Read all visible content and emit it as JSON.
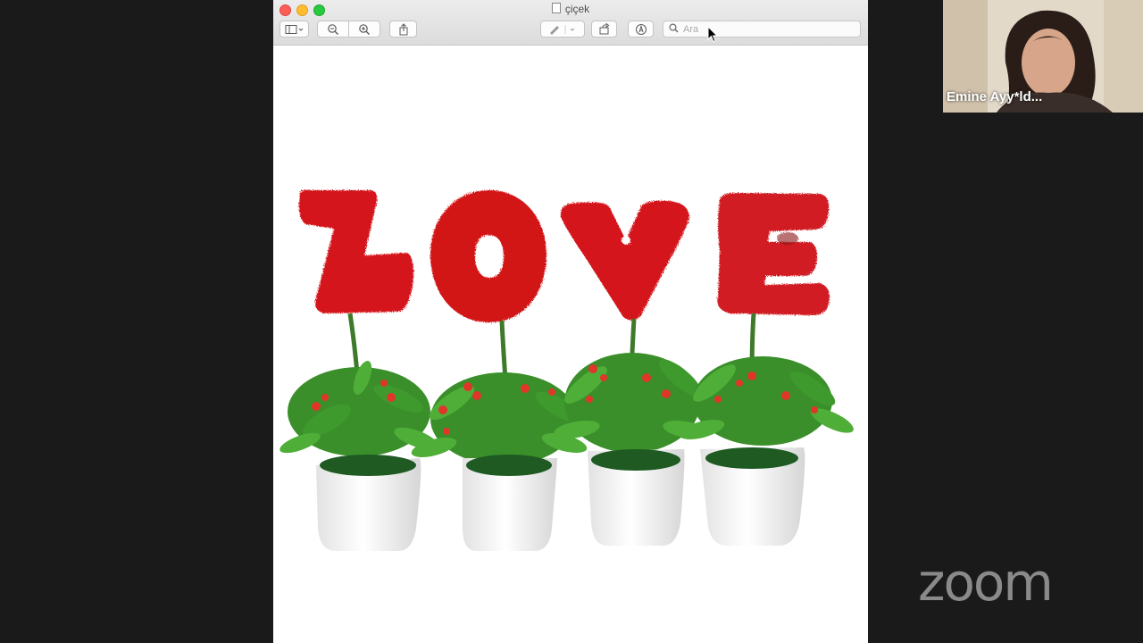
{
  "window": {
    "title": "çiçek",
    "search_placeholder": "Ara"
  },
  "toolbar": {
    "buttons": [
      {
        "name": "sidebar-toggle-button",
        "icon": "sidebar-icon"
      },
      {
        "name": "zoom-out-button",
        "icon": "zoom-out-icon"
      },
      {
        "name": "zoom-in-button",
        "icon": "zoom-in-icon"
      },
      {
        "name": "share-button",
        "icon": "share-icon"
      },
      {
        "name": "markup-pen-button",
        "icon": "pen-icon"
      },
      {
        "name": "rotate-button",
        "icon": "rotate-icon"
      },
      {
        "name": "annotate-button",
        "icon": "markup-icon"
      }
    ]
  },
  "image": {
    "letters": [
      "L",
      "O",
      "V",
      "E"
    ],
    "colors": {
      "letter": "#d4141c",
      "leaf": "#3f9a2e",
      "pot": "#f2f2f2",
      "soil": "#1e5a22",
      "flower": "#e0362a"
    }
  },
  "participant": {
    "name": "Emine Ayy*ld..."
  },
  "branding": {
    "logo": "zoom"
  }
}
